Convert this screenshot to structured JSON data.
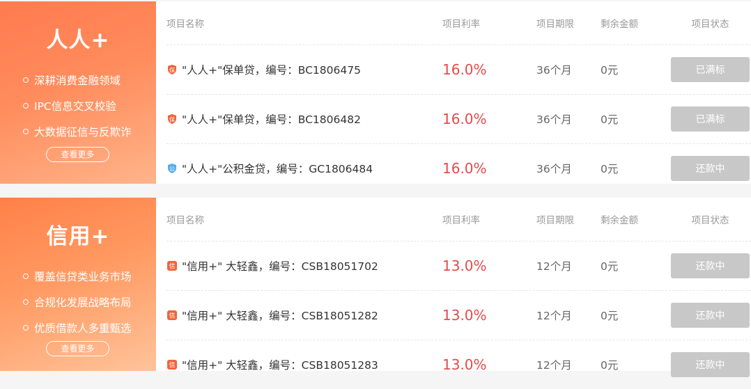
{
  "colors": {
    "accent_red": "#e64a4a",
    "status_gray": "#c8c8c8",
    "promo_orange": "#ff7a4f"
  },
  "sections": [
    {
      "promo": {
        "title": "人人+",
        "features": [
          "深耕消费金融领域",
          "IPC信息交叉校验",
          "大数据征信与反欺诈"
        ],
        "more_label": "查看更多"
      },
      "headers": {
        "name": "项目名称",
        "rate": "项目利率",
        "term": "项目期限",
        "remaining": "剩余金额",
        "status": "项目状态"
      },
      "rows": [
        {
          "icon": "shield-bao-icon",
          "icon_char": "保",
          "name": "\"人人+\"保单贷，编号：BC1806475",
          "rate": "16.0%",
          "term": "36个月",
          "remaining": "0元",
          "status": "已满标"
        },
        {
          "icon": "shield-bao-icon",
          "icon_char": "保",
          "name": "\"人人+\"保单贷，编号：BC1806482",
          "rate": "16.0%",
          "term": "36个月",
          "remaining": "0元",
          "status": "已满标"
        },
        {
          "icon": "shield-gong-icon",
          "icon_char": "公",
          "name": "\"人人+\"公积金贷，编号：GC1806484",
          "rate": "16.0%",
          "term": "36个月",
          "remaining": "0元",
          "status": "还款中"
        }
      ]
    },
    {
      "promo": {
        "title": "信用+",
        "features": [
          "覆盖信贷类业务市场",
          "合规化发展战略布局",
          "优质借款人多重甄选"
        ],
        "more_label": "查看更多"
      },
      "headers": {
        "name": "项目名称",
        "rate": "项目利率",
        "term": "项目期限",
        "remaining": "剩余金额",
        "status": "项目状态"
      },
      "rows": [
        {
          "icon": "credit-xin-icon",
          "icon_char": "信",
          "name": "\"信用+\" 大轻鑫，编号：CSB18051702",
          "rate": "13.0%",
          "term": "12个月",
          "remaining": "0元",
          "status": "还款中"
        },
        {
          "icon": "credit-xin-icon",
          "icon_char": "信",
          "name": "\"信用+\" 大轻鑫，编号：CSB18051282",
          "rate": "13.0%",
          "term": "12个月",
          "remaining": "0元",
          "status": "还款中"
        },
        {
          "icon": "credit-xin-icon",
          "icon_char": "信",
          "name": "\"信用+\" 大轻鑫，编号：CSB18051283",
          "rate": "13.0%",
          "term": "12个月",
          "remaining": "0元",
          "status": "还款中"
        }
      ]
    }
  ]
}
